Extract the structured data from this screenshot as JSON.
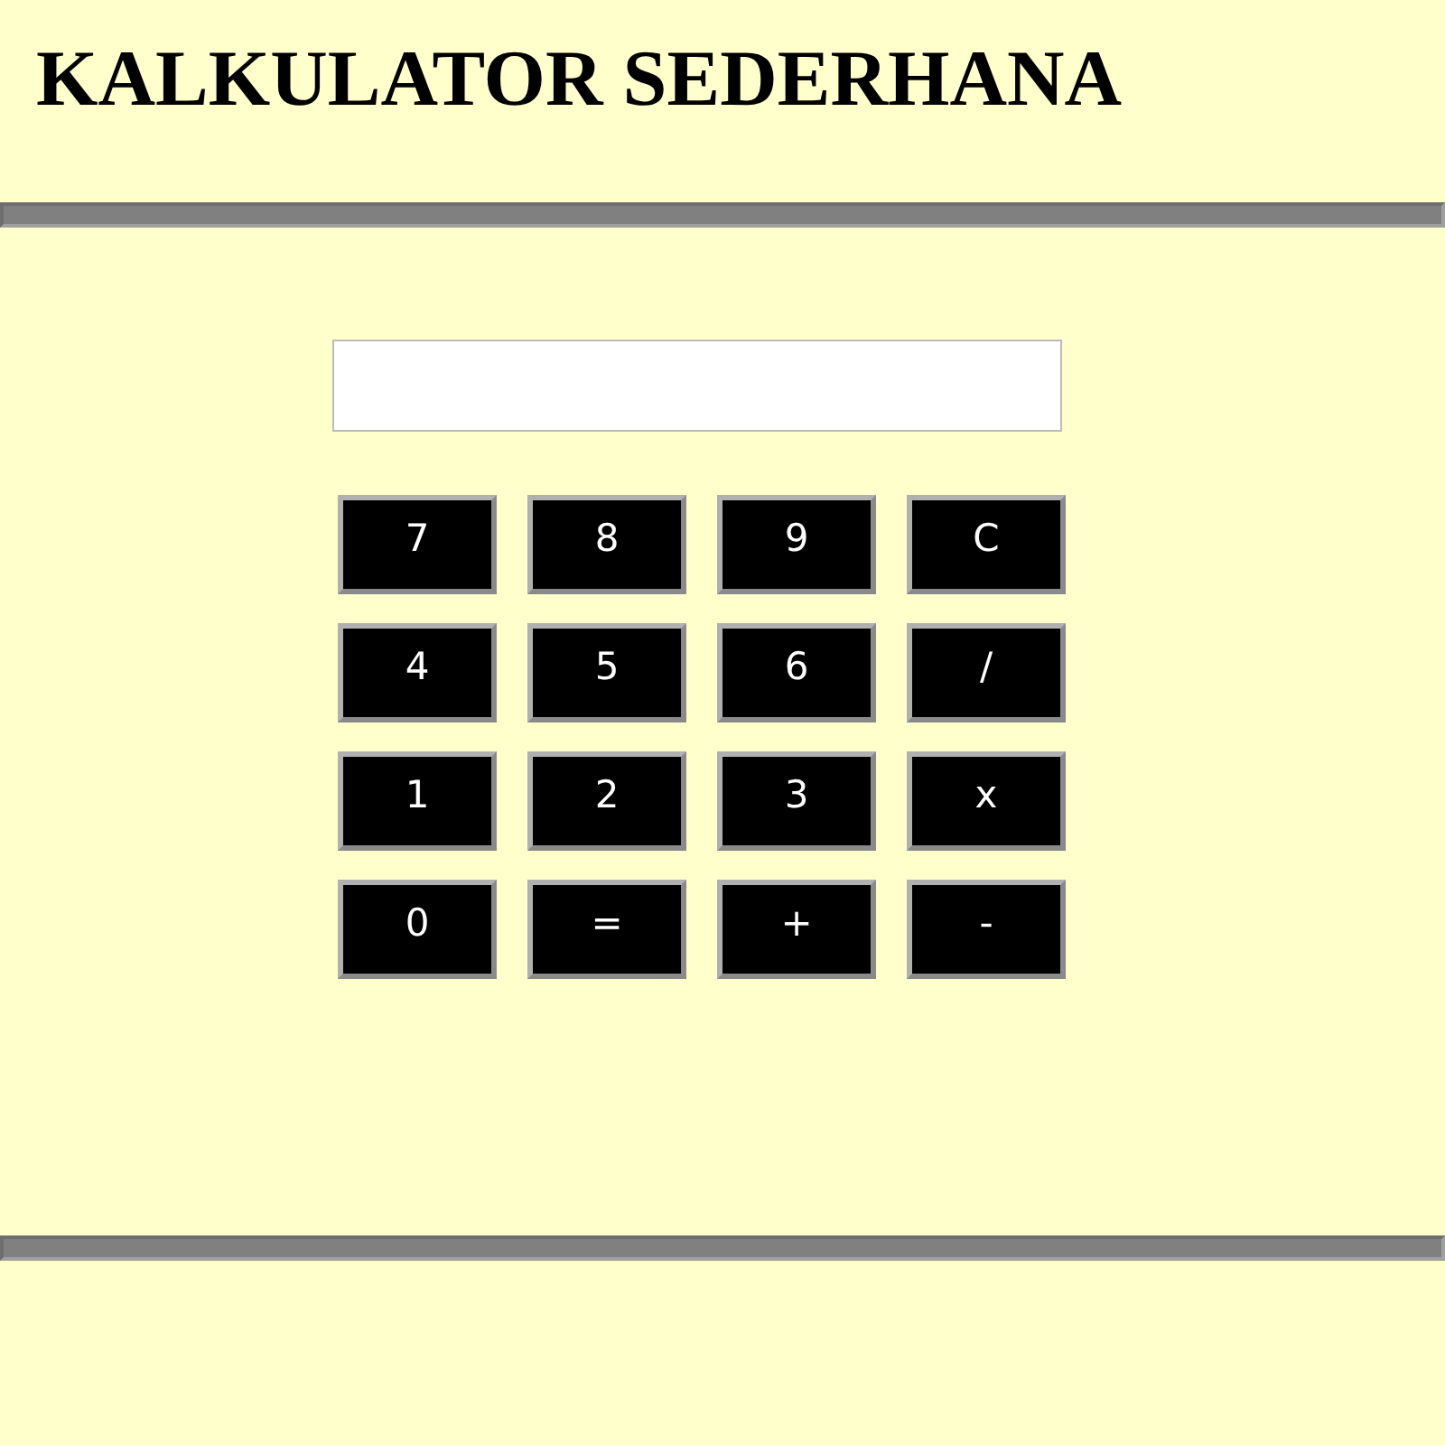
{
  "title": "KALKULATOR SEDERHANA",
  "keypad": [
    [
      "7",
      "8",
      "9",
      "C"
    ],
    [
      "4",
      "5",
      "6",
      "/"
    ],
    [
      "1",
      "2",
      "3",
      "x"
    ],
    [
      "0",
      "=",
      "+",
      "-"
    ]
  ]
}
